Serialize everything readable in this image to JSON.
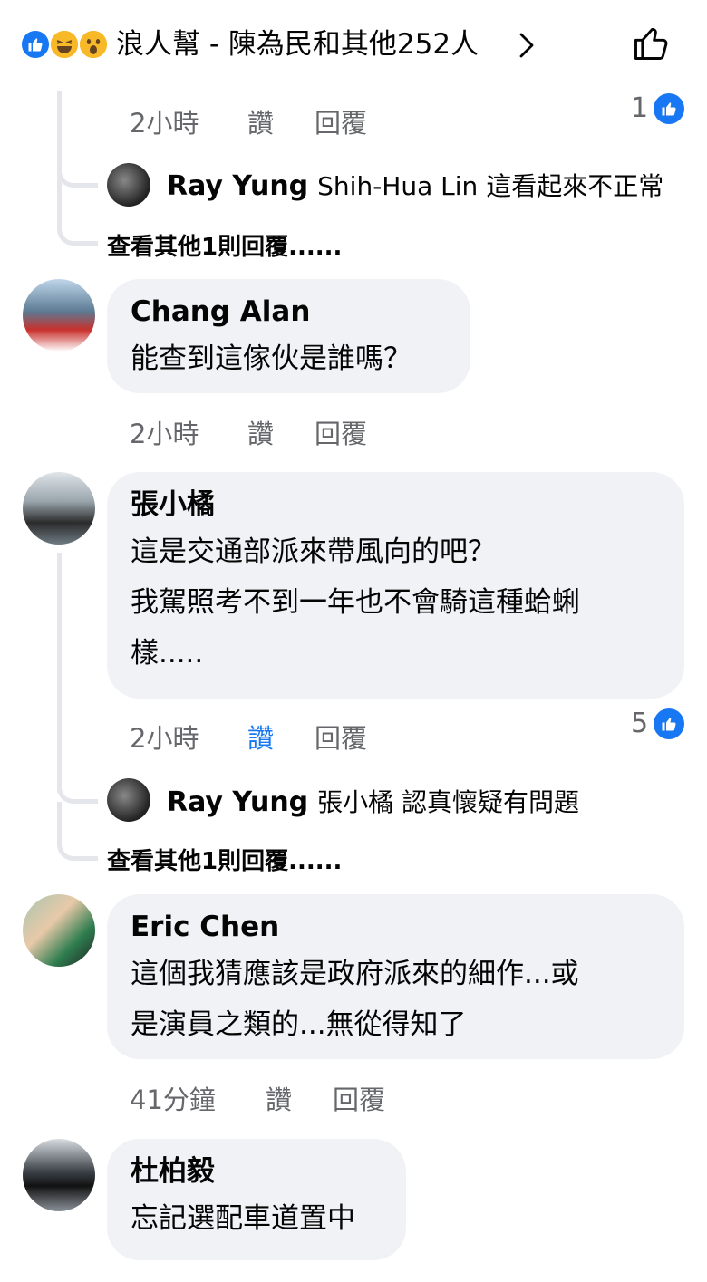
{
  "header": {
    "reaction_summary": "浪人幫 - 陳為民和其他252人",
    "reaction_icons": [
      "like-icon",
      "haha-icon",
      "wow-icon"
    ],
    "colors": {
      "accent": "#1877f2",
      "bubble": "#f0f2f5",
      "meta": "#65676b"
    }
  },
  "top_fragment": {
    "time": "2小時",
    "like": "讚",
    "reply": "回覆",
    "like_count": "1",
    "reply_preview": {
      "author": "Ray Yung",
      "text": "Shih-Hua Lin 這看起來不正常"
    },
    "more_replies": "查看其他1則回覆......"
  },
  "comments": [
    {
      "author": "Chang Alan",
      "text": "能查到這傢伙是誰嗎？",
      "time": "2小時",
      "like": "讚",
      "reply": "回覆"
    },
    {
      "author": "張小橘",
      "lines": [
        "這是交通部派來帶風向的吧？",
        "我駕照考不到一年也不會騎這種蛤蜊",
        "樣....."
      ],
      "time": "2小時",
      "like": "讚",
      "reply": "回覆",
      "like_count": "5",
      "reply_preview": {
        "author": "Ray Yung",
        "text": "張小橘 認真懷疑有問題"
      },
      "more_replies": "查看其他1則回覆......"
    },
    {
      "author": "Eric Chen",
      "lines": [
        "這個我猜應該是政府派來的細作...或",
        "是演員之類的...無從得知了"
      ],
      "time": "41分鐘",
      "like": "讚",
      "reply": "回覆"
    },
    {
      "author": "杜柏毅",
      "text": "忘記選配車道置中"
    }
  ]
}
